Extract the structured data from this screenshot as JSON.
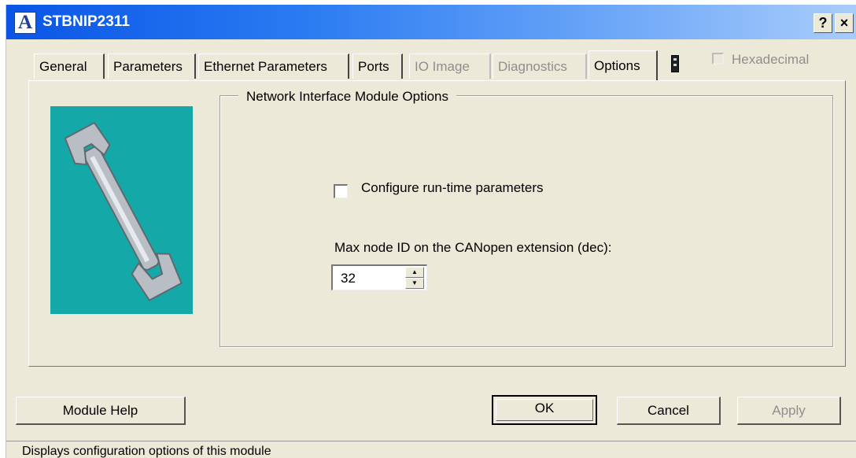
{
  "window": {
    "title": "STBNIP2311",
    "app_icon_letter": "A",
    "help_button": "?",
    "close_button": "×"
  },
  "tabs": [
    {
      "label": "General",
      "state": "normal"
    },
    {
      "label": "Parameters",
      "state": "normal"
    },
    {
      "label": "Ethernet Parameters",
      "state": "normal"
    },
    {
      "label": "Ports",
      "state": "normal"
    },
    {
      "label": "IO Image",
      "state": "disabled"
    },
    {
      "label": "Diagnostics",
      "state": "disabled"
    },
    {
      "label": "Options",
      "state": "active"
    }
  ],
  "hexadecimal": {
    "label": "Hexadecimal",
    "checked": false,
    "enabled": false
  },
  "options_page": {
    "group_title": "Network Interface Module Options",
    "run_time_label": "Configure run-time parameters",
    "run_time_checked": false,
    "max_node_label": "Max node ID on the CANopen extension (dec):",
    "max_node_value": "32"
  },
  "buttons": {
    "module_help": "Module Help",
    "ok": "OK",
    "cancel": "Cancel",
    "apply": "Apply"
  },
  "status": {
    "text": "Displays configuration options of this module"
  },
  "colors": {
    "title_bar": "#0a55e6",
    "picture_bg": "#14a9a8",
    "dialog_bg": "#ece9d8"
  }
}
